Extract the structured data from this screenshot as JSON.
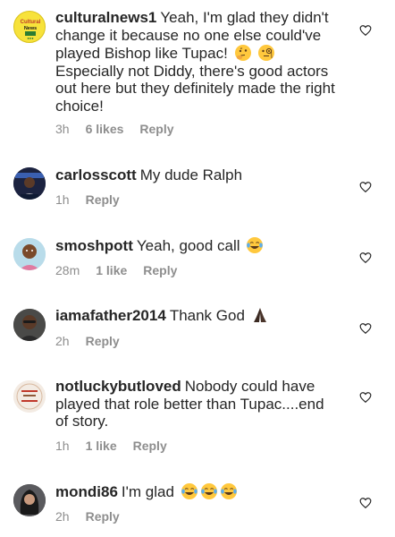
{
  "comments": [
    {
      "username": "culturalnews1",
      "text": "Yeah, I'm glad they didn't change it because no one else could've played Bishop like Tupac!",
      "text2": "Especially not Diddy, there's good actors out here but they definitely made the right choice!",
      "emojis": [
        "thinking-face-emoji",
        "face-with-monocle-emoji"
      ],
      "time": "3h",
      "likes": "6 likes",
      "reply": "Reply",
      "avatar_icon": "cultural-news-logo",
      "avatar_label": "Cultural News"
    },
    {
      "username": "carlosscott",
      "text": "My dude Ralph",
      "time": "1h",
      "reply": "Reply",
      "avatar_icon": "profile-photo"
    },
    {
      "username": "smoshpott",
      "text": "Yeah, good call",
      "emojis": [
        "tears-of-joy-emoji"
      ],
      "time": "28m",
      "likes": "1 like",
      "reply": "Reply",
      "avatar_icon": "profile-photo"
    },
    {
      "username": "iamafather2014",
      "text": "Thank God",
      "emojis": [
        "folded-hands-emoji"
      ],
      "time": "2h",
      "reply": "Reply",
      "avatar_icon": "profile-photo"
    },
    {
      "username": "notluckybutloved",
      "text": "Nobody could have played that role better than Tupac....end of story.",
      "time": "1h",
      "likes": "1 like",
      "reply": "Reply",
      "avatar_icon": "profile-photo"
    },
    {
      "username": "mondi86",
      "text": "I'm glad",
      "emojis": [
        "tears-of-joy-emoji",
        "tears-of-joy-emoji",
        "tears-of-joy-emoji"
      ],
      "time": "2h",
      "reply": "Reply",
      "avatar_icon": "profile-photo"
    }
  ],
  "icons": {
    "like": "heart-outline-icon"
  },
  "colors": {
    "text": "#262626",
    "meta": "#8e8e8e",
    "emoji_face": "#FFC83D",
    "skin_dark": "#3b2a22"
  }
}
